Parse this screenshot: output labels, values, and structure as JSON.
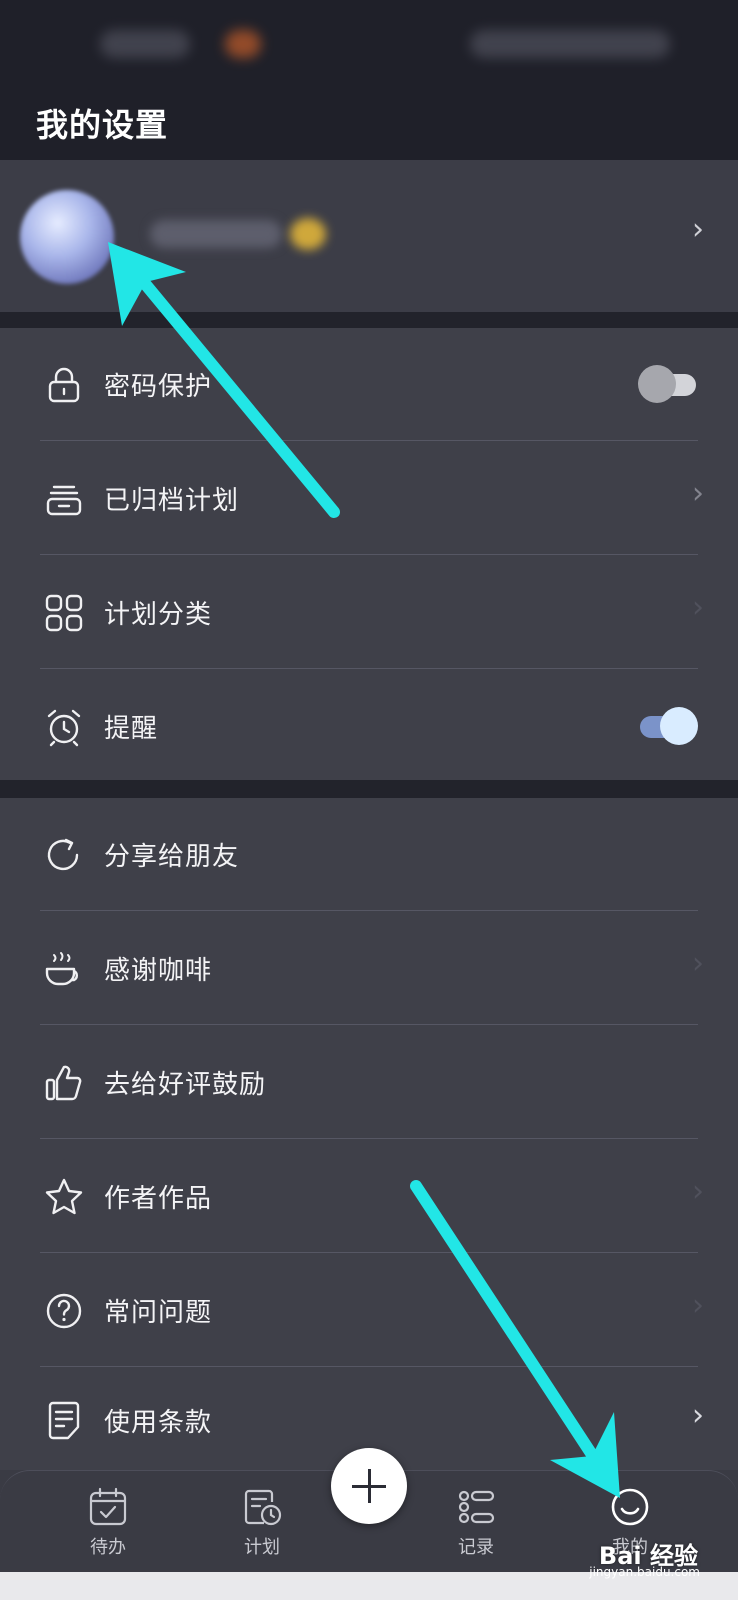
{
  "header": {
    "title": "我的设置"
  },
  "profile": {
    "chevron": "›"
  },
  "settings_group_1": [
    {
      "label": "密码保护",
      "icon": "lock-icon",
      "control": "toggle",
      "on": false
    },
    {
      "label": "已归档计划",
      "icon": "archive-icon",
      "control": "chevron"
    },
    {
      "label": "计划分类",
      "icon": "grid-icon",
      "control": "chevron"
    },
    {
      "label": "提醒",
      "icon": "alarm-clock-icon",
      "control": "toggle",
      "on": true
    }
  ],
  "settings_group_2": [
    {
      "label": "分享给朋友",
      "icon": "share-icon"
    },
    {
      "label": "感谢咖啡",
      "icon": "coffee-cup-icon"
    },
    {
      "label": "去给好评鼓励",
      "icon": "thumbs-up-icon"
    },
    {
      "label": "作者作品",
      "icon": "star-icon"
    },
    {
      "label": "常问问题",
      "icon": "question-icon"
    },
    {
      "label": "使用条款",
      "icon": "document-icon"
    }
  ],
  "chevron_glyph": "›",
  "tabbar": {
    "tabs": [
      {
        "label": "待办",
        "icon": "calendar-check-icon"
      },
      {
        "label": "计划",
        "icon": "plan-clock-icon"
      },
      {
        "label": "记录",
        "icon": "list-icon"
      },
      {
        "label": "我的",
        "icon": "smiley-icon",
        "active": true
      }
    ],
    "add_icon": "plus-icon"
  },
  "watermark": {
    "brand": "Bai  经验",
    "url": "jingyan.baidu.com"
  },
  "colors": {
    "background": "#3a3b44",
    "header": "#1f2029",
    "accent_toggle": "#7b93c9",
    "annotation_arrow": "#22e6e6"
  }
}
